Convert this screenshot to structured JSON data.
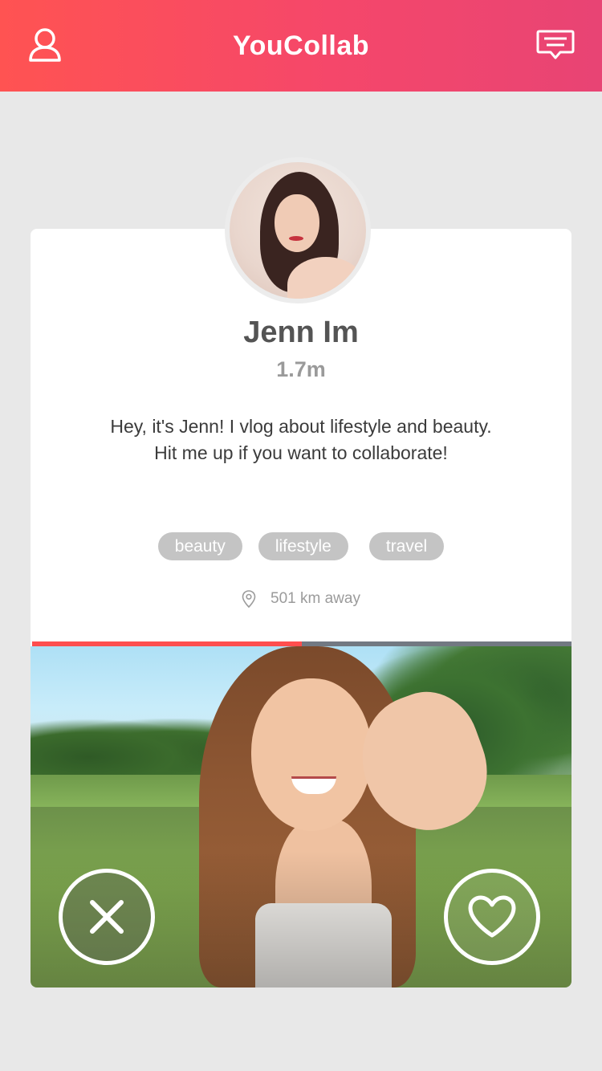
{
  "header": {
    "title": "YouCollab",
    "profile_icon": "user-icon",
    "messages_icon": "chat-icon"
  },
  "colors": {
    "header_gradient_start": "#ff5352",
    "header_gradient_end": "#e84474",
    "background": "#e8e8e8",
    "progress_accent": "#ff4e4e",
    "tag_bg": "#c4c4c4"
  },
  "profile": {
    "name": "Jenn Im",
    "subscribers": "1.7m",
    "bio": "Hey, it's Jenn! I vlog about lifestyle and beauty. Hit me up if you want to collaborate!",
    "tags": [
      {
        "label": "beauty"
      },
      {
        "label": "lifestyle"
      },
      {
        "label": "travel"
      }
    ],
    "distance": "501 km away",
    "location_icon": "location-pin-icon"
  },
  "video": {
    "progress_fraction": 0.5
  },
  "actions": {
    "pass_icon": "close-icon",
    "like_icon": "heart-icon"
  }
}
